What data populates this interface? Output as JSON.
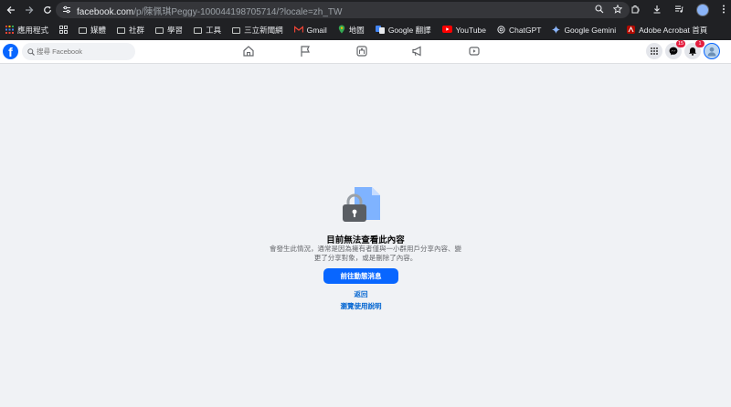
{
  "browser": {
    "url_host": "facebook.com",
    "url_path": "/p/陳佩琪Peggy-100044198705714/?locale=zh_TW",
    "bookmarks": [
      {
        "label": "應用程式",
        "icon": "apps-grid-icon"
      },
      {
        "label": "",
        "icon": "apps-grid-icon"
      },
      {
        "label": "媒體",
        "icon": "folder-icon"
      },
      {
        "label": "社群",
        "icon": "folder-icon"
      },
      {
        "label": "學習",
        "icon": "folder-icon"
      },
      {
        "label": "工具",
        "icon": "folder-icon"
      },
      {
        "label": "三立新聞網",
        "icon": "folder-icon"
      },
      {
        "label": "Gmail",
        "icon": "gmail-icon"
      },
      {
        "label": "地圖",
        "icon": "maps-icon"
      },
      {
        "label": "Google 翻譯",
        "icon": "translate-icon"
      },
      {
        "label": "YouTube",
        "icon": "youtube-icon"
      },
      {
        "label": "ChatGPT",
        "icon": "chatgpt-icon"
      },
      {
        "label": "Google Gemini",
        "icon": "gemini-icon"
      },
      {
        "label": "Adobe Acrobat 首頁",
        "icon": "acrobat-icon"
      }
    ]
  },
  "facebook": {
    "search_placeholder": "搜尋 Facebook",
    "messenger_badge": "15",
    "notifications_badge": "1"
  },
  "main": {
    "title": "目前無法查看此內容",
    "description": "會發生此情況，通常是因為擁有者僅與一小群用戶分享內容、變更了分享對象，或是刪除了內容。",
    "primary_button": "前往動態消息",
    "back_link": "返回",
    "help_link": "瀏覽使用說明"
  },
  "colors": {
    "brand": "#0866ff",
    "link": "#0064d1",
    "background": "#f0f2f5",
    "badge": "#e41e3f"
  }
}
